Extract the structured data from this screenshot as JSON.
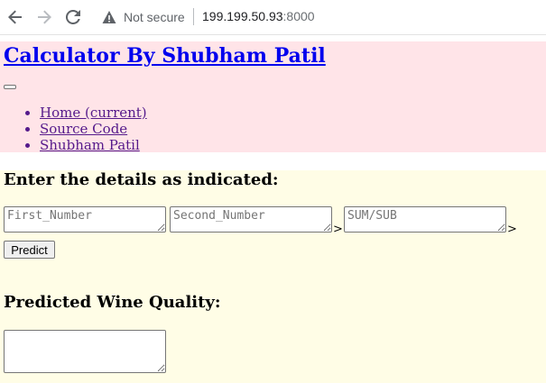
{
  "browser": {
    "security_label": "Not secure",
    "url_host": "199.199.50.93",
    "url_port": ":8000"
  },
  "header": {
    "brand": "Calculator By Shubham Patil",
    "nav_items": [
      {
        "label": "Home (current)"
      },
      {
        "label": "Source Code"
      },
      {
        "label": "Shubham Patil"
      }
    ]
  },
  "form": {
    "title": "Enter the details as indicated:",
    "fields": [
      {
        "placeholder": "First_Number",
        "value": ""
      },
      {
        "placeholder": "Second_Number",
        "value": ""
      },
      {
        "placeholder": "SUM/SUB",
        "value": ""
      }
    ],
    "separator": ">",
    "submit_label": "Predict"
  },
  "result": {
    "title": "Predicted Wine Quality:",
    "value": ""
  }
}
